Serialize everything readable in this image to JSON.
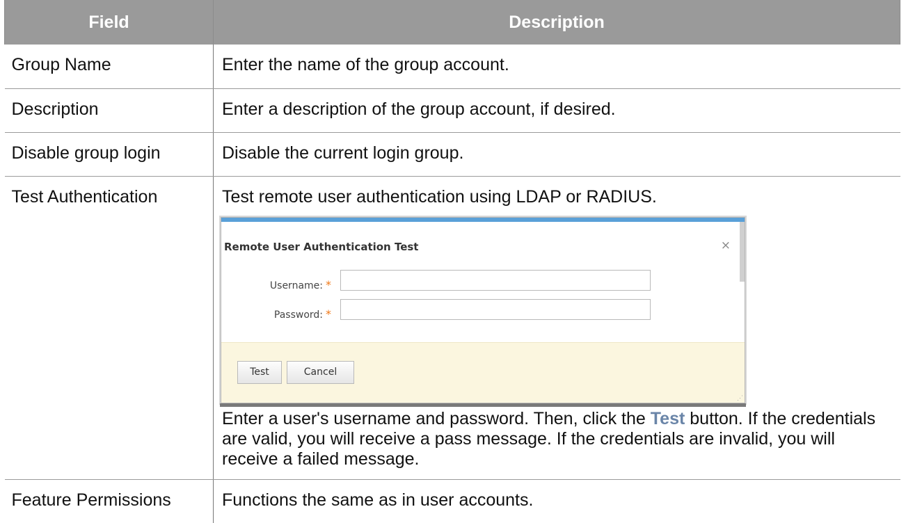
{
  "table": {
    "headers": {
      "field": "Field",
      "description": "Description"
    },
    "rows": [
      {
        "field": "Group Name",
        "description": "Enter the name of the group account."
      },
      {
        "field": "Description",
        "description": "Enter a description of the group account, if desired."
      },
      {
        "field": "Disable group login",
        "description": "Disable the current login group."
      },
      {
        "field": "Test Authentication",
        "description": "Test remote user authentication using LDAP or RADIUS.",
        "note_before": "Enter a user's username and password. Then, click the ",
        "note_highlight": "Test",
        "note_after": " button. If the credentials are valid, you will receive a pass message. If the credentials are invalid, you will receive a failed message."
      },
      {
        "field": "Feature Permissions",
        "description": "Functions the same as in user accounts."
      }
    ]
  },
  "dialog": {
    "title": "Remote User Authentication Test",
    "close_icon": "close-icon",
    "username_label": "Username:",
    "password_label": "Password:",
    "required_marker": "*",
    "username_value": "",
    "password_value": "",
    "test_button": "Test",
    "cancel_button": "Cancel"
  },
  "colors": {
    "header_bg": "#9a9a9a",
    "highlight_text": "#6a85a8",
    "dialog_accent": "#5aa0d8",
    "required_marker": "#f07818",
    "footer_bg": "#fbf6df"
  }
}
